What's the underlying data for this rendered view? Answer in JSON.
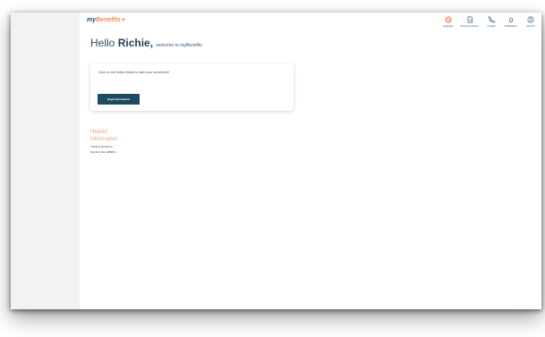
{
  "logo": {
    "my": "my",
    "benefits": "Benefits",
    "star": "✦"
  },
  "topnav": [
    {
      "label": "Language",
      "icon": "globe-icon",
      "color": "#e0663a"
    },
    {
      "label": "Document Library",
      "icon": "document-icon",
      "color": "#1f4a6e"
    },
    {
      "label": "Contact",
      "icon": "phone-icon",
      "color": "#1f4a6e"
    },
    {
      "label": "Notifications",
      "icon": "bell-icon",
      "color": "#1f4a6e"
    },
    {
      "label": "Account",
      "icon": "user-icon",
      "color": "#1f4a6e"
    }
  ],
  "greeting": {
    "hello": "Hello",
    "name": "Richie,",
    "welcome": "welcome to myBenefits"
  },
  "card": {
    "instruction": "Click on the button below to start your enrollment!",
    "button_label": "Begin Enrollment"
  },
  "helpful": {
    "title": "Helpful\nInformation",
    "links": [
      "Tracking Sessions ›",
      "Member Doc (EBHS) ›"
    ]
  },
  "colors": {
    "brand_navy": "#1d4b63",
    "accent_orange": "#ef8a52"
  }
}
